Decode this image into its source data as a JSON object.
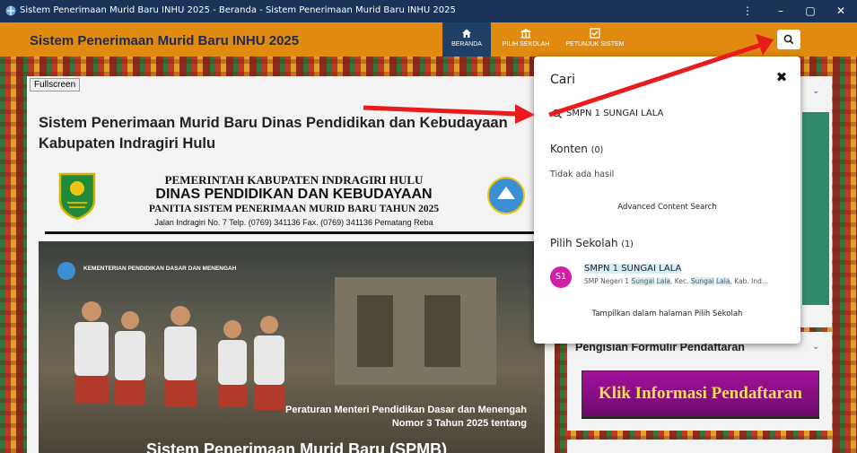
{
  "window": {
    "title": "Sistem Penerimaan Murid Baru INHU 2025 - Beranda - Sistem Penerimaan Murid Baru INHU 2025",
    "menu_glyph": "⋮",
    "min_glyph": "–",
    "max_glyph": "▢",
    "close_glyph": "✕"
  },
  "navbar": {
    "brand": "Sistem Penerimaan Murid Baru INHU 2025",
    "items": [
      {
        "label": "BERANDA",
        "icon": "home-icon",
        "active": true
      },
      {
        "label": "PILIH SEKOLAH",
        "icon": "school-icon",
        "active": false
      },
      {
        "label": "PETUNJUK SISTEM",
        "icon": "checklist-icon",
        "active": false
      }
    ],
    "search_icon": "search-icon"
  },
  "main": {
    "fullscreen_label": "Fullscreen",
    "heading": "Sistem Penerimaan Murid Baru Dinas Pendidikan dan Kebudayaan Kabupaten Indragiri Hulu",
    "letterhead": {
      "line1": "PEMERINTAH KABUPATEN INDRAGIRI HULU",
      "line2": "DINAS PENDIDIKAN DAN KEBUDAYAAN",
      "line3": "PANITIA SISTEM PENERIMAAN MURID BARU TAHUN 2025",
      "line4": "Jalan Indragiri No. 7 Telp. (0769) 341136 Fax. (0769) 341136 Pematang Reba"
    },
    "hero": {
      "ministry": "KEMENTERIAN PENDIDIKAN DASAR DAN MENENGAH",
      "caption_line1": "Peraturan Menteri Pendidikan Dasar dan Menengah",
      "caption_line2": "Nomor 3 Tahun 2025 tentang",
      "big_title": "Sistem Penerimaan Murid Baru (SPMB)"
    }
  },
  "sidebar": {
    "card2_title": "Pengisian Formulir Pendaftaran",
    "klik_button": "Klik Informasi Pendaftaran"
  },
  "search_popup": {
    "title": "Cari",
    "close_glyph": "✖",
    "query": "SMPN 1 SUNGAI LALA",
    "konten": {
      "label": "Konten",
      "count": "(0)"
    },
    "no_result": "Tidak ada hasil",
    "advanced": "Advanced Content Search",
    "sekolah": {
      "label": "Pilih Sekolah",
      "count": "(1)"
    },
    "result": {
      "avatar": "S1",
      "name": "SMPN 1 SUNGAI LALA",
      "desc_a": "SMP Negeri 1 ",
      "desc_b": "Sungai",
      "desc_c": " ",
      "desc_d": "Lala",
      "desc_e": ", Kec. ",
      "desc_f": "Sungai",
      "desc_g": " ",
      "desc_h": "Lala",
      "desc_i": ", Kab. Ind..."
    },
    "show_all": "Tampilkan dalam halaman Pilih Sekolah"
  },
  "colors": {
    "navbar": "#e08a10",
    "nav_active": "#1f3f66",
    "titlebar": "#1b3358",
    "avatar": "#d41ca6",
    "arrow": "#e81c1c",
    "klik_bg": "#a1129a",
    "klik_text": "#f5e04a"
  }
}
